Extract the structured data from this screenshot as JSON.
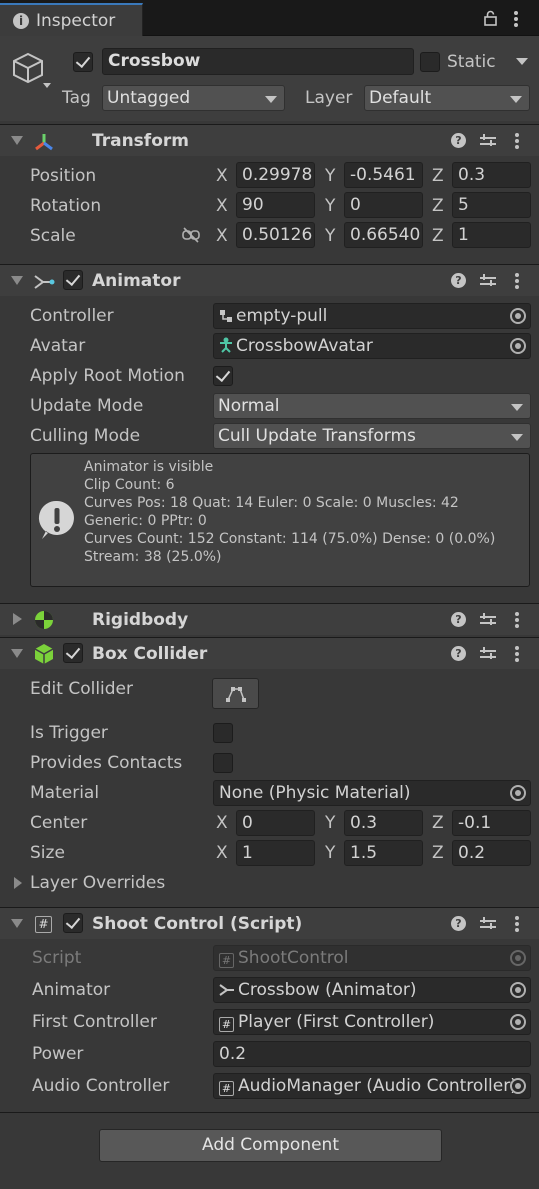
{
  "tab": {
    "title": "Inspector"
  },
  "header": {
    "name": "Crossbow",
    "static_label": "Static",
    "tag_label": "Tag",
    "tag_value": "Untagged",
    "layer_label": "Layer",
    "layer_value": "Default"
  },
  "transform": {
    "title": "Transform",
    "position": {
      "label": "Position",
      "x": "0.29978",
      "y": "-0.5461",
      "z": "0.3"
    },
    "rotation": {
      "label": "Rotation",
      "x": "90",
      "y": "0",
      "z": "5"
    },
    "scale": {
      "label": "Scale",
      "x": "0.50126",
      "y": "0.66540",
      "z": "1"
    },
    "axis_x": "X",
    "axis_y": "Y",
    "axis_z": "Z"
  },
  "animator": {
    "title": "Animator",
    "controller_label": "Controller",
    "controller_value": "empty-pull",
    "avatar_label": "Avatar",
    "avatar_value": "CrossbowAvatar",
    "root_motion_label": "Apply Root Motion",
    "update_mode_label": "Update Mode",
    "update_mode_value": "Normal",
    "culling_mode_label": "Culling Mode",
    "culling_mode_value": "Cull Update Transforms",
    "info": [
      "Animator is visible",
      "Clip Count: 6",
      "Curves Pos: 18 Quat: 14 Euler: 0 Scale: 0 Muscles: 42",
      "Generic: 0 PPtr: 0",
      "Curves Count: 152 Constant: 114 (75.0%) Dense: 0 (0.0%)",
      "Stream: 38 (25.0%)"
    ]
  },
  "rigidbody": {
    "title": "Rigidbody"
  },
  "box_collider": {
    "title": "Box Collider",
    "edit_collider_label": "Edit Collider",
    "is_trigger_label": "Is Trigger",
    "provides_contacts_label": "Provides Contacts",
    "material_label": "Material",
    "material_value": "None (Physic Material)",
    "center": {
      "label": "Center",
      "x": "0",
      "y": "0.3",
      "z": "-0.1"
    },
    "size": {
      "label": "Size",
      "x": "1",
      "y": "1.5",
      "z": "0.2"
    },
    "layer_overrides_label": "Layer Overrides"
  },
  "shoot_control": {
    "title": "Shoot Control (Script)",
    "script_label": "Script",
    "script_value": "ShootControl",
    "animator_label": "Animator",
    "animator_value": "Crossbow (Animator)",
    "first_controller_label": "First Controller",
    "first_controller_value": "Player (First Controller)",
    "power_label": "Power",
    "power_value": "0.2",
    "audio_controller_label": "Audio Controller",
    "audio_controller_value": "AudioManager (Audio Controller)"
  },
  "add_component_label": "Add Component",
  "colors": {
    "background": "#383838",
    "header": "#3e3e3e",
    "field": "#2a2a2a",
    "tab_accent": "#3a79bb"
  }
}
